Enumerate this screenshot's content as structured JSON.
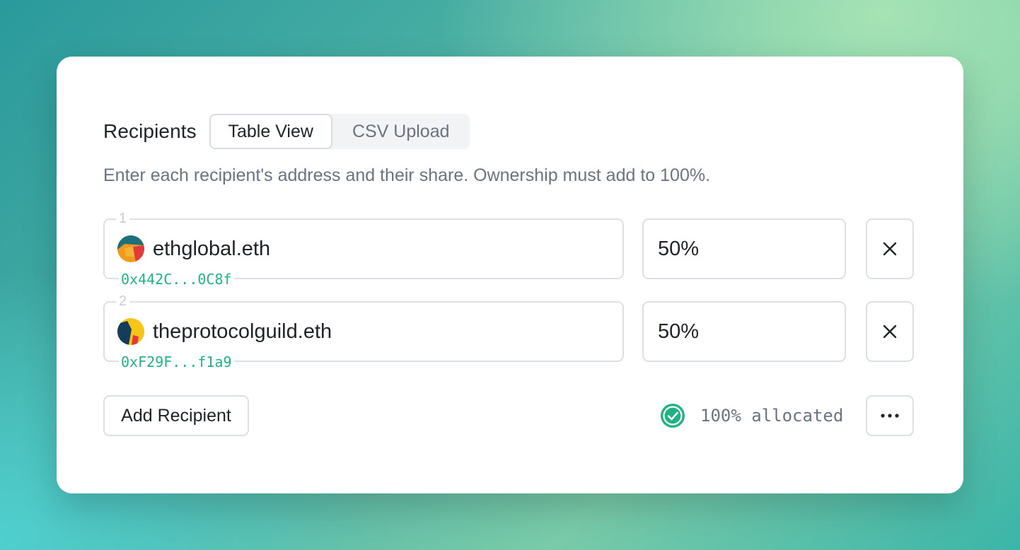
{
  "header": {
    "title": "Recipients",
    "tabs": [
      {
        "label": "Table View",
        "active": true
      },
      {
        "label": "CSV Upload",
        "active": false
      }
    ]
  },
  "description": "Enter each recipient's address and their share. Ownership must add to 100%.",
  "recipients": [
    {
      "index": "1",
      "ens": "ethglobal.eth",
      "address": "0x442C...0C8f",
      "share": "50%"
    },
    {
      "index": "2",
      "ens": "theprotocolguild.eth",
      "address": "0xF29F...f1a9",
      "share": "50%"
    }
  ],
  "footer": {
    "add_label": "Add Recipient",
    "status": "100% allocated"
  },
  "colors": {
    "accent_green": "#1fb383",
    "border": "#dcdfe3",
    "muted_text": "#6b7280"
  },
  "icons": [
    "remove-icon",
    "check-circle-icon",
    "more-icon"
  ]
}
